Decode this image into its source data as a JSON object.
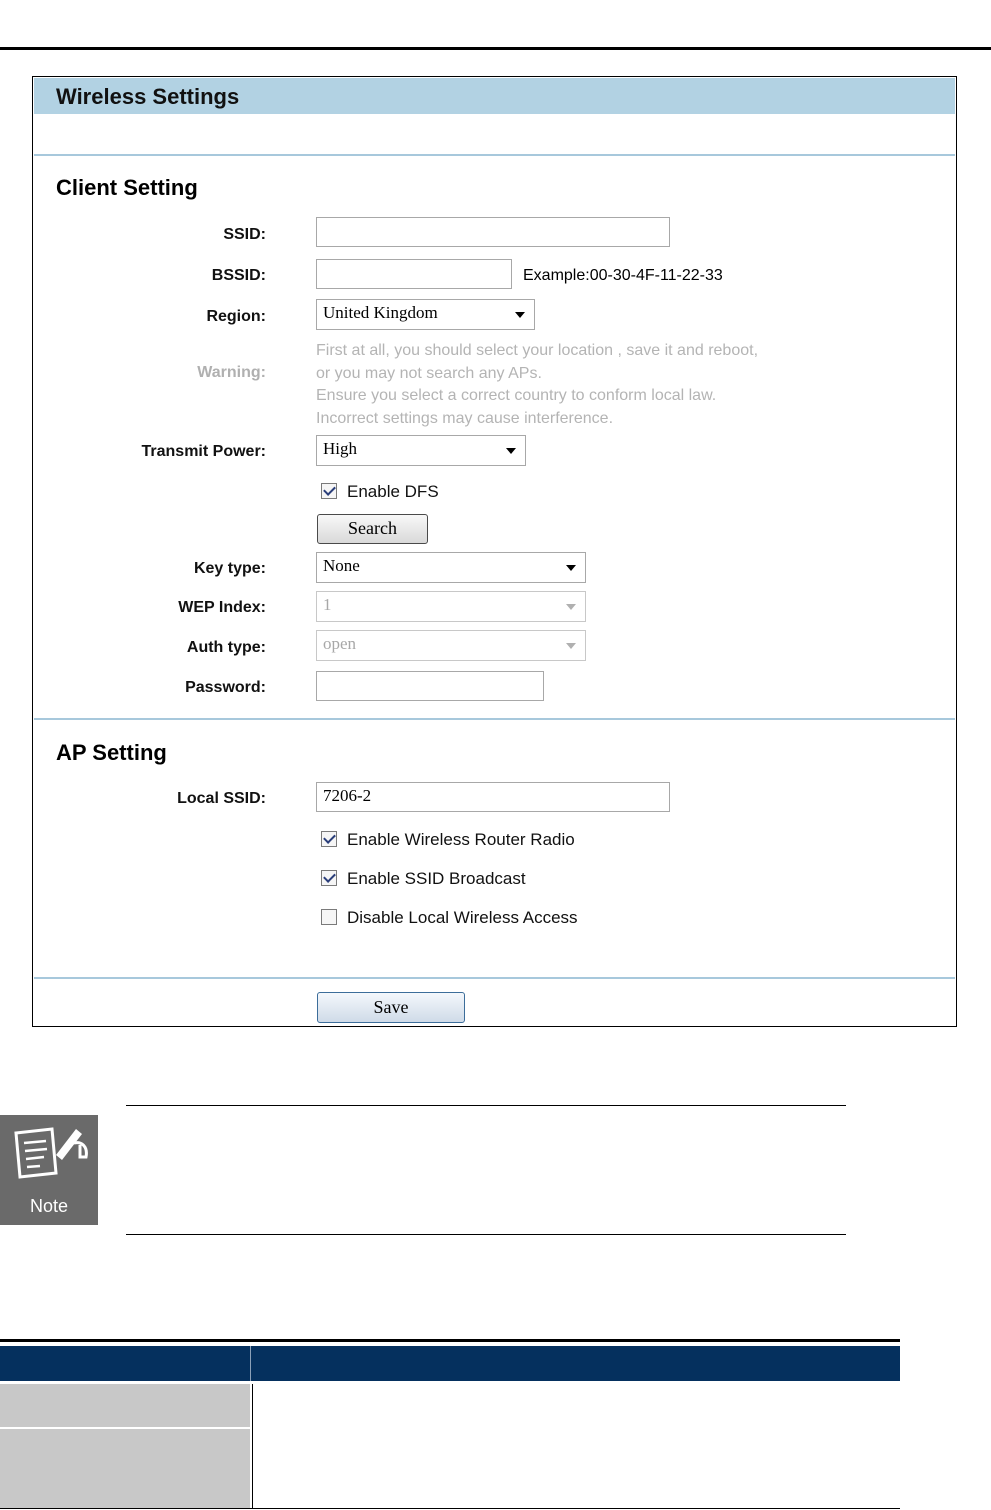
{
  "panel": {
    "title": "Wireless Settings"
  },
  "client": {
    "title": "Client Setting",
    "ssid_label": "SSID:",
    "ssid_value": "",
    "bssid_label": "BSSID:",
    "bssid_value": "",
    "bssid_example": "Example:00-30-4F-11-22-33",
    "region_label": "Region:",
    "region_value": "United Kingdom",
    "warning_label": "Warning:",
    "warning_lines": [
      "First at all, you should select your location , save it and reboot,",
      "or you may not search any APs.",
      "Ensure you select a correct country to conform local law.",
      "Incorrect settings may cause interference."
    ],
    "transmit_power_label": "Transmit Power:",
    "transmit_power_value": "High",
    "enable_dfs_label": "Enable DFS",
    "enable_dfs_checked": true,
    "search_button": "Search",
    "key_type_label": "Key type:",
    "key_type_value": "None",
    "wep_index_label": "WEP Index:",
    "wep_index_value": "1",
    "auth_type_label": "Auth type:",
    "auth_type_value": "open",
    "password_label": "Password:",
    "password_value": ""
  },
  "ap": {
    "title": "AP Setting",
    "local_ssid_label": "Local SSID:",
    "local_ssid_value": "7206-2",
    "enable_radio_label": "Enable Wireless Router Radio",
    "enable_radio_checked": true,
    "enable_ssid_broadcast_label": "Enable SSID Broadcast",
    "enable_ssid_broadcast_checked": true,
    "disable_local_access_label": "Disable Local Wireless Access",
    "disable_local_access_checked": false
  },
  "save_button": "Save",
  "note": {
    "icon_label": "Note"
  }
}
